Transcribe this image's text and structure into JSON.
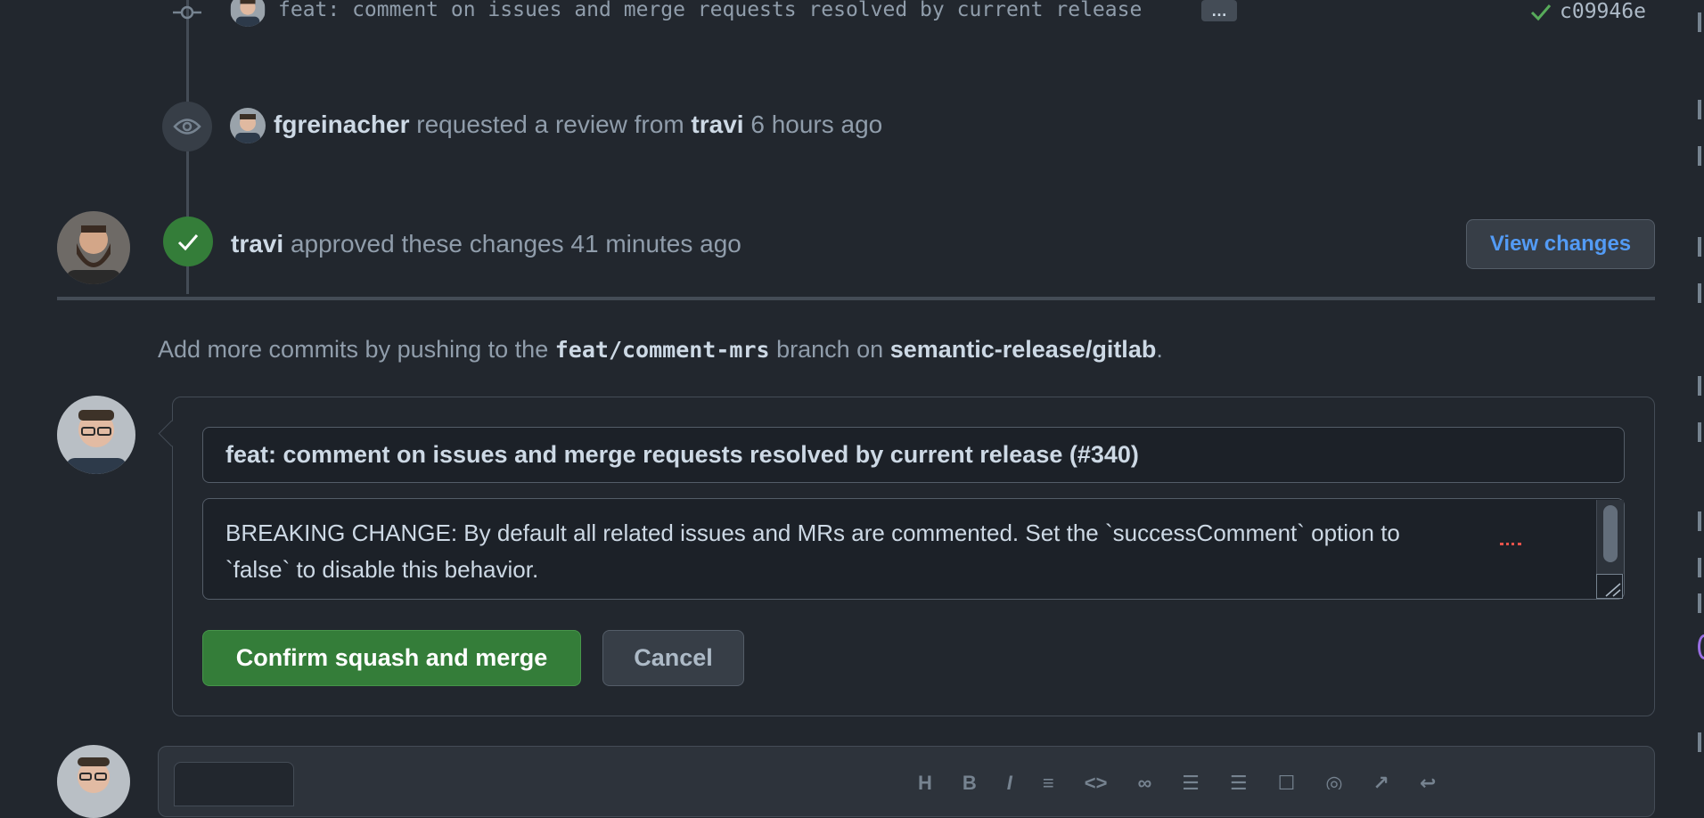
{
  "commit": {
    "message": "feat: comment on issues and merge requests resolved by current release",
    "ellipsis": "…",
    "hash": "c09946e"
  },
  "review_request": {
    "actor": "fgreinacher",
    "text": "requested a review from",
    "reviewer": "travi",
    "time": "6 hours ago"
  },
  "approval": {
    "actor": "travi",
    "text": "approved these changes",
    "time": "41 minutes ago",
    "view_changes_label": "View changes"
  },
  "push_hint": {
    "prefix": "Add more commits by pushing to the",
    "branch": "feat/comment-mrs",
    "middle": "branch on",
    "repo": "semantic-release/gitlab",
    "suffix": "."
  },
  "merge_form": {
    "title_value": "feat: comment on issues and merge requests resolved by current release (#340)",
    "body_line1": "BREAKING CHANGE: By default all related issues and MRs are commented. Set the `successComment` option to",
    "body_line2": "`false` to disable this behavior.",
    "confirm_label": "Confirm squash and merge",
    "cancel_label": "Cancel"
  },
  "colors": {
    "background": "#22272e",
    "accent_green": "#347d39",
    "approved_badge": "#347d39",
    "link_blue": "#539bf5",
    "border": "#444c56"
  },
  "icons": {
    "commit": "git-commit-icon",
    "eye": "eye-icon",
    "check": "check-icon"
  }
}
